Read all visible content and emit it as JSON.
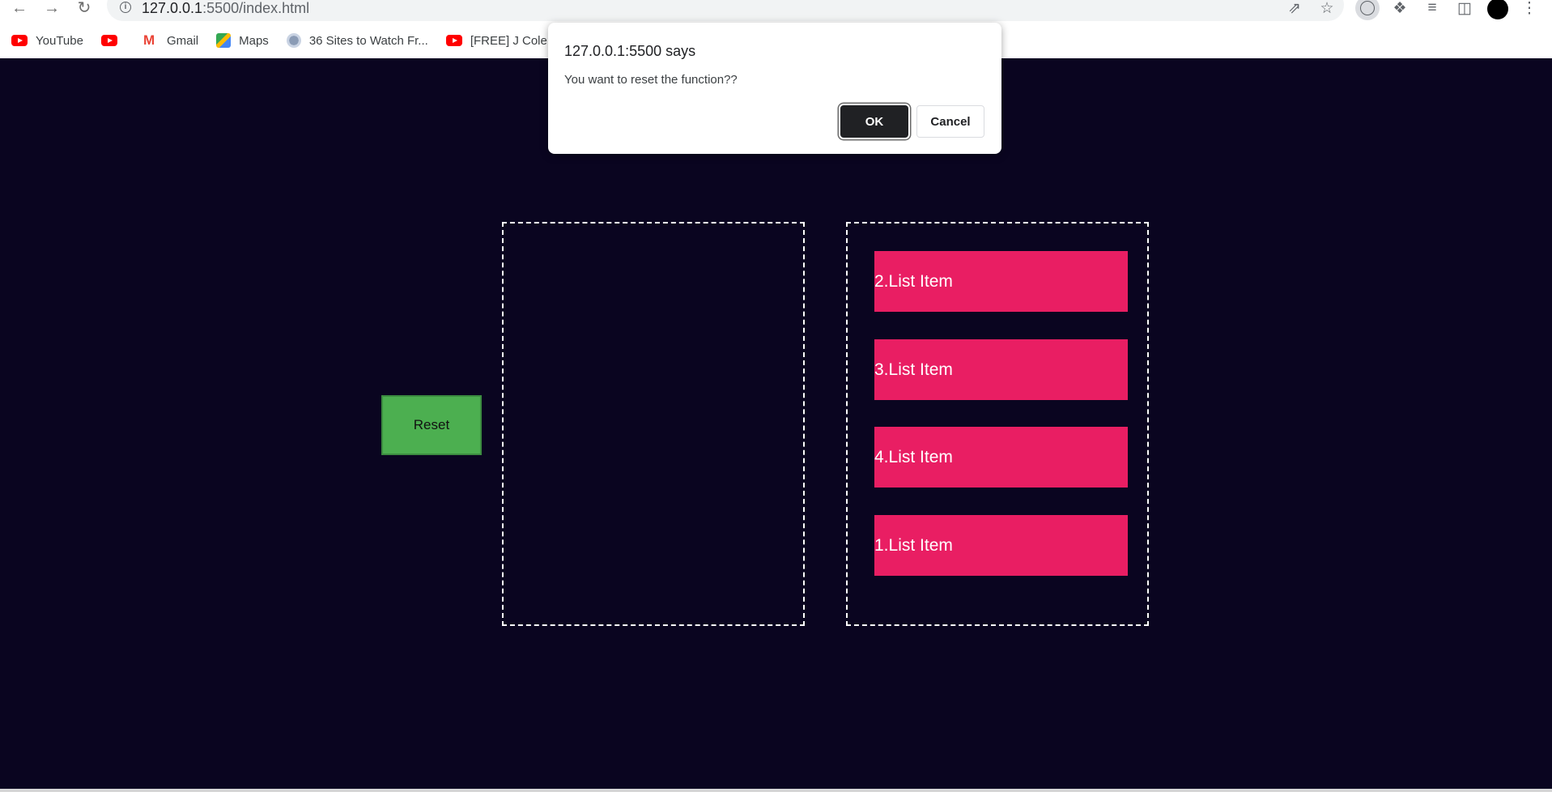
{
  "browser": {
    "url_host": "127.0.0.1",
    "url_rest": ":5500/index.html",
    "icons": {
      "back": "arrow-left-icon",
      "forward": "arrow-right-icon",
      "reload": "reload-icon",
      "info": "info-icon",
      "share": "share-icon",
      "bookmark": "star-icon",
      "extensions": "puzzle-icon",
      "media": "media-queue-icon",
      "sidepanel": "side-panel-icon",
      "menu": "kebab-menu-icon"
    }
  },
  "bookmarks": [
    {
      "label": "YouTube",
      "icon": "youtube-icon"
    },
    {
      "label": "",
      "icon": "youtube-icon"
    },
    {
      "label": "Gmail",
      "icon": "gmail-icon"
    },
    {
      "label": "Maps",
      "icon": "maps-icon"
    },
    {
      "label": "36 Sites to Watch Fr...",
      "icon": "site-icon"
    },
    {
      "label": "[FREE] J Cole Type",
      "icon": "youtube-icon"
    }
  ],
  "page": {
    "background": "#0a0520",
    "reset_label": "Reset",
    "reset_color": "#4caf50",
    "item_color": "#e91e63",
    "right_list": [
      "2.List Item",
      "3.List Item",
      "4.List Item",
      "1.List Item"
    ]
  },
  "dialog": {
    "title": "127.0.0.1:5500 says",
    "message": "You want to reset the function??",
    "ok_label": "OK",
    "cancel_label": "Cancel"
  }
}
